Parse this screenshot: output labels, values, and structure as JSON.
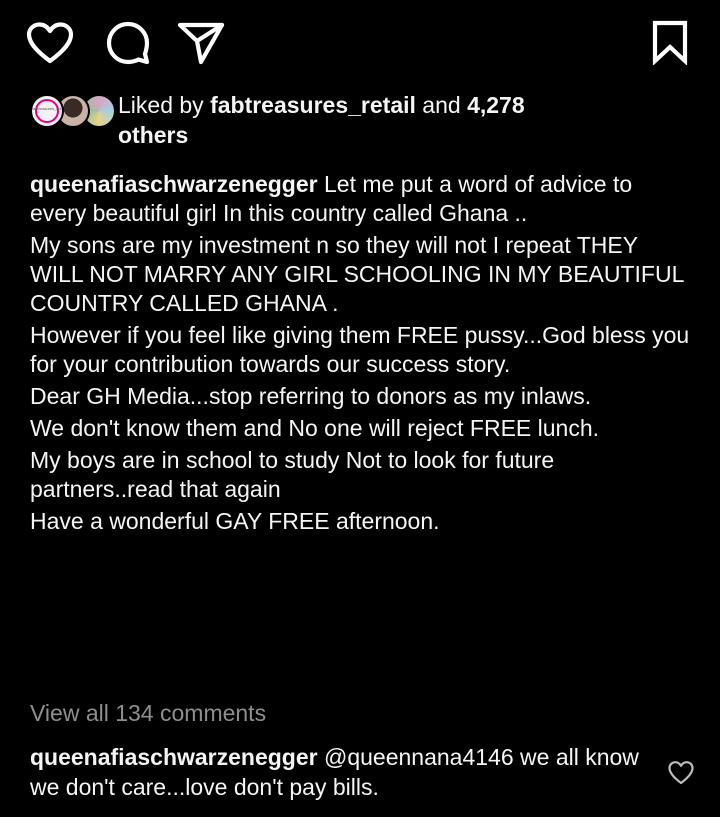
{
  "actions": {
    "like_icon": "heart-outline-icon",
    "comment_icon": "comment-bubble-icon",
    "share_icon": "paper-plane-icon",
    "save_icon": "bookmark-outline-icon",
    "icon_color": "#ffffff"
  },
  "likes": {
    "prefix": "Liked by ",
    "user": "fabtreasures_retail",
    "middle": " and ",
    "count": "4,278",
    "suffix": "others",
    "avatar_1_text": "fabtreasures_retail"
  },
  "caption": {
    "username": "queenafiaschwarzenegger",
    "lines": [
      "Let me put a word of advice to every beautiful girl In this country called Ghana ..",
      "My sons are my investment n so they will not I repeat THEY WILL NOT MARRY ANY GIRL SCHOOLING IN MY BEAUTIFUL COUNTRY CALLED GHANA .",
      "However if you feel like giving them FREE pussy...God bless you for your contribution towards our success story.",
      "Dear  GH Media...stop referring to donors as my inlaws.",
      "We don't know them and No one will reject FREE lunch.",
      "My boys are in school to study Not to look for future partners..read that again",
      "Have a wonderful GAY FREE afternoon."
    ]
  },
  "view_comments": "View all 134 comments",
  "comment": {
    "username": "queenafiaschwarzenegger",
    "text": " @queennana4146 we all know we don't care...love don't pay bills.",
    "like_icon": "heart-outline-icon"
  },
  "colors": {
    "background": "#000000",
    "text": "#f5f5f5",
    "muted": "#8e8e8e"
  }
}
